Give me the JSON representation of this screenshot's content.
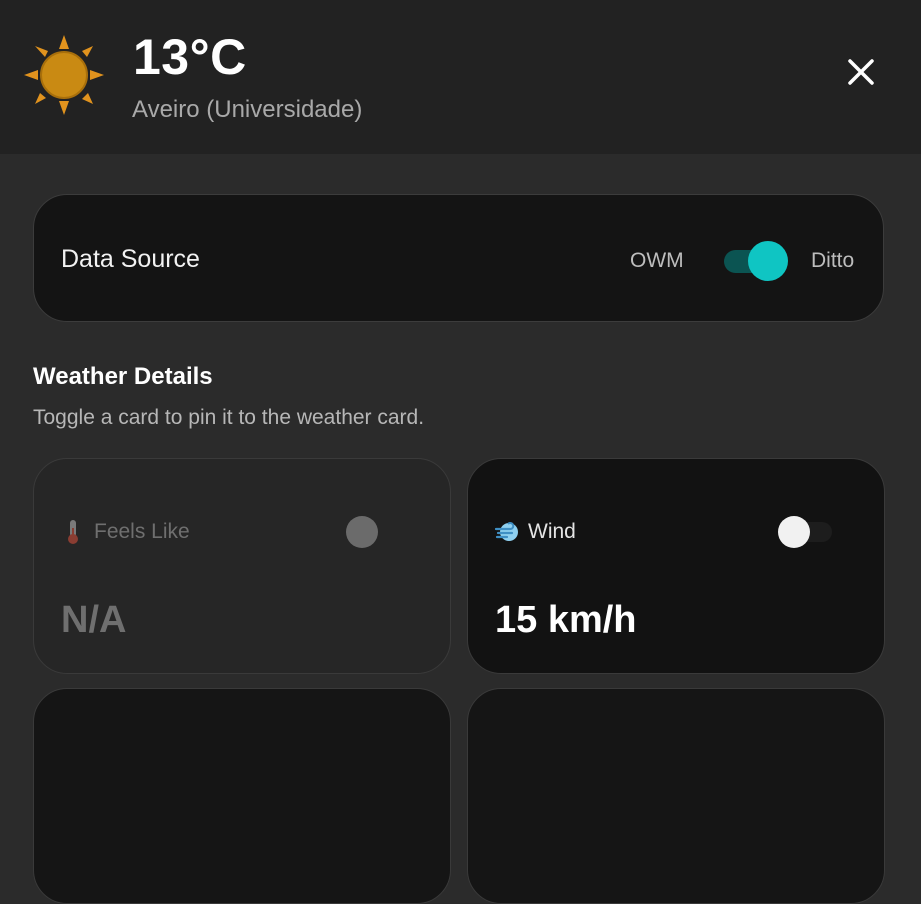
{
  "header": {
    "temperature": "13°C",
    "location": "Aveiro (Universidade)",
    "weather_icon": "sun-icon",
    "close_icon": "close-icon"
  },
  "data_source": {
    "label": "Data Source",
    "option_left": "OWM",
    "option_right": "Ditto",
    "selected": "Ditto",
    "accent_color": "#0fc5c3"
  },
  "weather_details": {
    "title": "Weather Details",
    "subtitle": "Toggle a card to pin it to the weather card.",
    "cards": [
      {
        "label": "Feels Like",
        "value": "N/A",
        "icon": "thermometer-icon",
        "pinned": false,
        "enabled": false
      },
      {
        "label": "Wind",
        "value": "15 km/h",
        "icon": "wind-icon",
        "pinned": false,
        "enabled": true
      }
    ]
  }
}
